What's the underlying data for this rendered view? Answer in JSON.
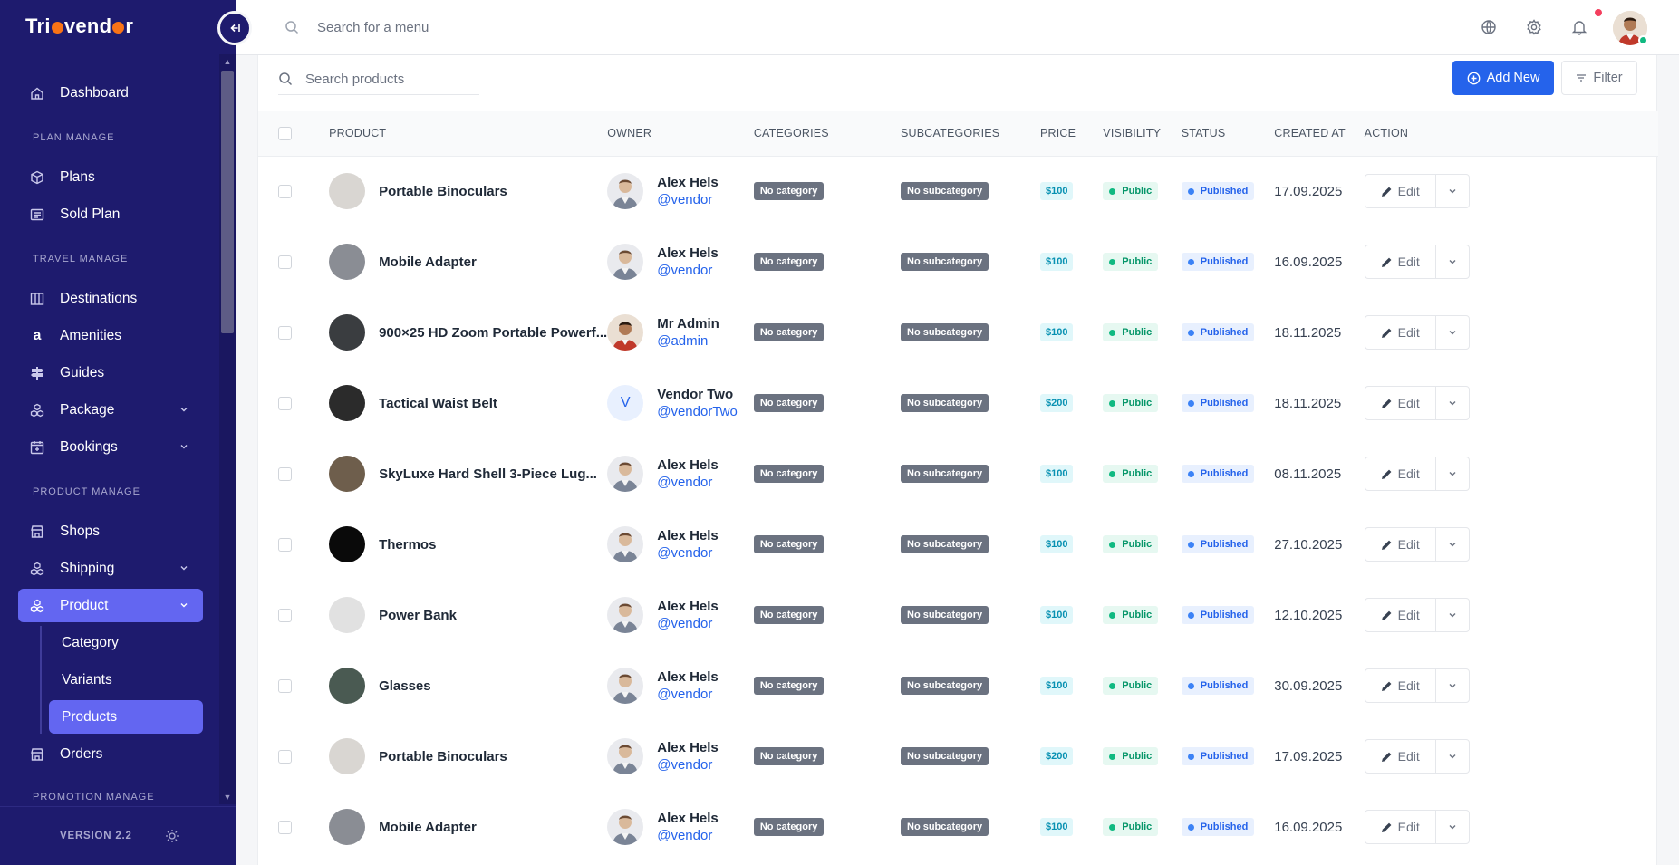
{
  "brand": {
    "name_start": "Tri",
    "name_end": "vend",
    "name_tail": "r"
  },
  "topbar": {
    "search_placeholder": "Search for a menu"
  },
  "sidebar": {
    "items_top": [
      {
        "label": "Dashboard"
      }
    ],
    "section_plan": "PLAN MANAGE",
    "items_plan": [
      {
        "label": "Plans"
      },
      {
        "label": "Sold Plan"
      }
    ],
    "section_travel": "TRAVEL MANAGE",
    "items_travel": [
      {
        "label": "Destinations"
      },
      {
        "label": "Amenities"
      },
      {
        "label": "Guides"
      },
      {
        "label": "Package"
      },
      {
        "label": "Bookings"
      }
    ],
    "section_product": "PRODUCT MANAGE",
    "items_product": [
      {
        "label": "Shops"
      },
      {
        "label": "Shipping"
      },
      {
        "label": "Product"
      }
    ],
    "product_sub": [
      {
        "label": "Category"
      },
      {
        "label": "Variants"
      },
      {
        "label": "Products"
      }
    ],
    "item_orders": "Orders",
    "section_promotion": "PROMOTION MANAGE",
    "version": "VERSION 2.2"
  },
  "toolbar": {
    "search_placeholder": "Search products",
    "add_label": "Add New",
    "filter_label": "Filter"
  },
  "table": {
    "headers": [
      "PRODUCT",
      "OWNER",
      "CATEGORIES",
      "SUBCATEGORIES",
      "PRICE",
      "VISIBILITY",
      "STATUS",
      "CREATED AT",
      "ACTION"
    ],
    "edit_label": "Edit",
    "rows": [
      {
        "product": "Portable Binoculars",
        "owner": "Alex Hels",
        "handle": "@vendor",
        "category": "No category",
        "subcategory": "No subcategory",
        "price": "$100",
        "visibility": "Public",
        "status": "Published",
        "created": "17.09.2025",
        "img": "#d9d6d2",
        "av": "man"
      },
      {
        "product": "Mobile Adapter",
        "owner": "Alex Hels",
        "handle": "@vendor",
        "category": "No category",
        "subcategory": "No subcategory",
        "price": "$100",
        "visibility": "Public",
        "status": "Published",
        "created": "16.09.2025",
        "img": "#8a8d94",
        "av": "man"
      },
      {
        "product": "900×25 HD Zoom Portable Powerf...",
        "owner": "Mr Admin",
        "handle": "@admin",
        "category": "No category",
        "subcategory": "No subcategory",
        "price": "$100",
        "visibility": "Public",
        "status": "Published",
        "created": "18.11.2025",
        "img": "#3a3d40",
        "av": "admin"
      },
      {
        "product": "Tactical Waist Belt",
        "owner": "Vendor Two",
        "handle": "@vendorTwo",
        "category": "No category",
        "subcategory": "No subcategory",
        "price": "$200",
        "visibility": "Public",
        "status": "Published",
        "created": "18.11.2025",
        "img": "#2b2b2b",
        "av": "V"
      },
      {
        "product": "SkyLuxe Hard Shell 3-Piece Lug...",
        "owner": "Alex Hels",
        "handle": "@vendor",
        "category": "No category",
        "subcategory": "No subcategory",
        "price": "$100",
        "visibility": "Public",
        "status": "Published",
        "created": "08.11.2025",
        "img": "#6e5e4c",
        "av": "man"
      },
      {
        "product": "Thermos",
        "owner": "Alex Hels",
        "handle": "@vendor",
        "category": "No category",
        "subcategory": "No subcategory",
        "price": "$100",
        "visibility": "Public",
        "status": "Published",
        "created": "27.10.2025",
        "img": "#0a0a0a",
        "av": "man"
      },
      {
        "product": "Power Bank",
        "owner": "Alex Hels",
        "handle": "@vendor",
        "category": "No category",
        "subcategory": "No subcategory",
        "price": "$100",
        "visibility": "Public",
        "status": "Published",
        "created": "12.10.2025",
        "img": "#e1e1e1",
        "av": "man"
      },
      {
        "product": "Glasses",
        "owner": "Alex Hels",
        "handle": "@vendor",
        "category": "No category",
        "subcategory": "No subcategory",
        "price": "$100",
        "visibility": "Public",
        "status": "Published",
        "created": "30.09.2025",
        "img": "#4a5a52",
        "av": "man"
      },
      {
        "product": "Portable Binoculars",
        "owner": "Alex Hels",
        "handle": "@vendor",
        "category": "No category",
        "subcategory": "No subcategory",
        "price": "$200",
        "visibility": "Public",
        "status": "Published",
        "created": "17.09.2025",
        "img": "#d9d6d2",
        "av": "man"
      },
      {
        "product": "Mobile Adapter",
        "owner": "Alex Hels",
        "handle": "@vendor",
        "category": "No category",
        "subcategory": "No subcategory",
        "price": "$100",
        "visibility": "Public",
        "status": "Published",
        "created": "16.09.2025",
        "img": "#8a8d94",
        "av": "man"
      }
    ]
  },
  "icons": {
    "collapse": "collapse-icon",
    "globe": "globe-icon",
    "gear": "gear-icon",
    "bell": "bell-icon",
    "sun": "sun-icon"
  },
  "colors": {
    "sidebar": "#1e1b6e",
    "accent": "#6366f1",
    "primary": "#2563eb"
  }
}
